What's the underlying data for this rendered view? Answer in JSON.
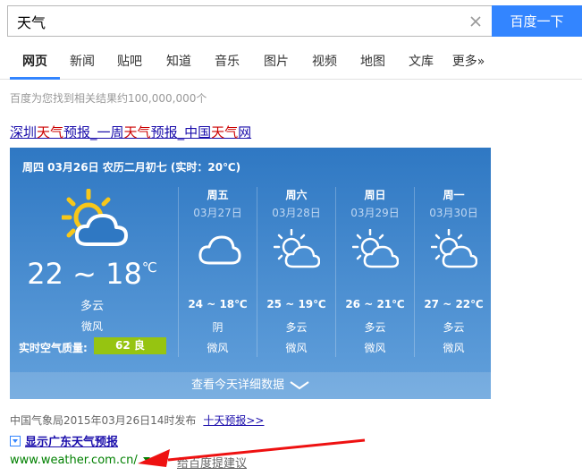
{
  "search": {
    "query": "天气",
    "button_label": "百度一下"
  },
  "tabs": [
    "网页",
    "新闻",
    "贴吧",
    "知道",
    "音乐",
    "图片",
    "视频",
    "地图",
    "文库",
    "更多»"
  ],
  "result_count": "百度为您找到相关结果约100,000,000个",
  "result_title": {
    "part1": "深圳",
    "hl1": "天气",
    "part2": "预报_一周",
    "hl2": "天气",
    "part3": "预报_中国",
    "hl3": "天气",
    "part4": "网"
  },
  "weather": {
    "header": "周四 03月26日 农历二月初七 (实时：20℃)",
    "today": {
      "temp": "22 ~ 18",
      "unit": "℃",
      "condition": "多云",
      "wind": "微风",
      "aqi_label": "实时空气质量:",
      "aqi_value": "62 良"
    },
    "days": [
      {
        "name": "周五",
        "date": "03月27日",
        "temp": "24 ~ 18℃",
        "condition": "阴",
        "wind": "微风",
        "icon": "cloudy-icon"
      },
      {
        "name": "周六",
        "date": "03月28日",
        "temp": "25 ~ 19℃",
        "condition": "多云",
        "wind": "微风",
        "icon": "partly-cloudy-icon"
      },
      {
        "name": "周日",
        "date": "03月29日",
        "temp": "26 ~ 21℃",
        "condition": "多云",
        "wind": "微风",
        "icon": "partly-cloudy-icon"
      },
      {
        "name": "周一",
        "date": "03月30日",
        "temp": "27 ~ 22℃",
        "condition": "多云",
        "wind": "微风",
        "icon": "partly-cloudy-icon"
      }
    ],
    "more_label": "查看今天详细数据"
  },
  "source": {
    "text": "中国气象局2015年03月26日14时发布",
    "link": "十天预报>>"
  },
  "expand_label": "显示广东天气预报",
  "url": "www.weather.com.cn/",
  "feedback": "给百度提建议",
  "colors": {
    "accent": "#3385ff",
    "card_top": "#2f78c3",
    "aqi": "#96c411",
    "url": "#008000",
    "highlight": "#cc0000"
  }
}
